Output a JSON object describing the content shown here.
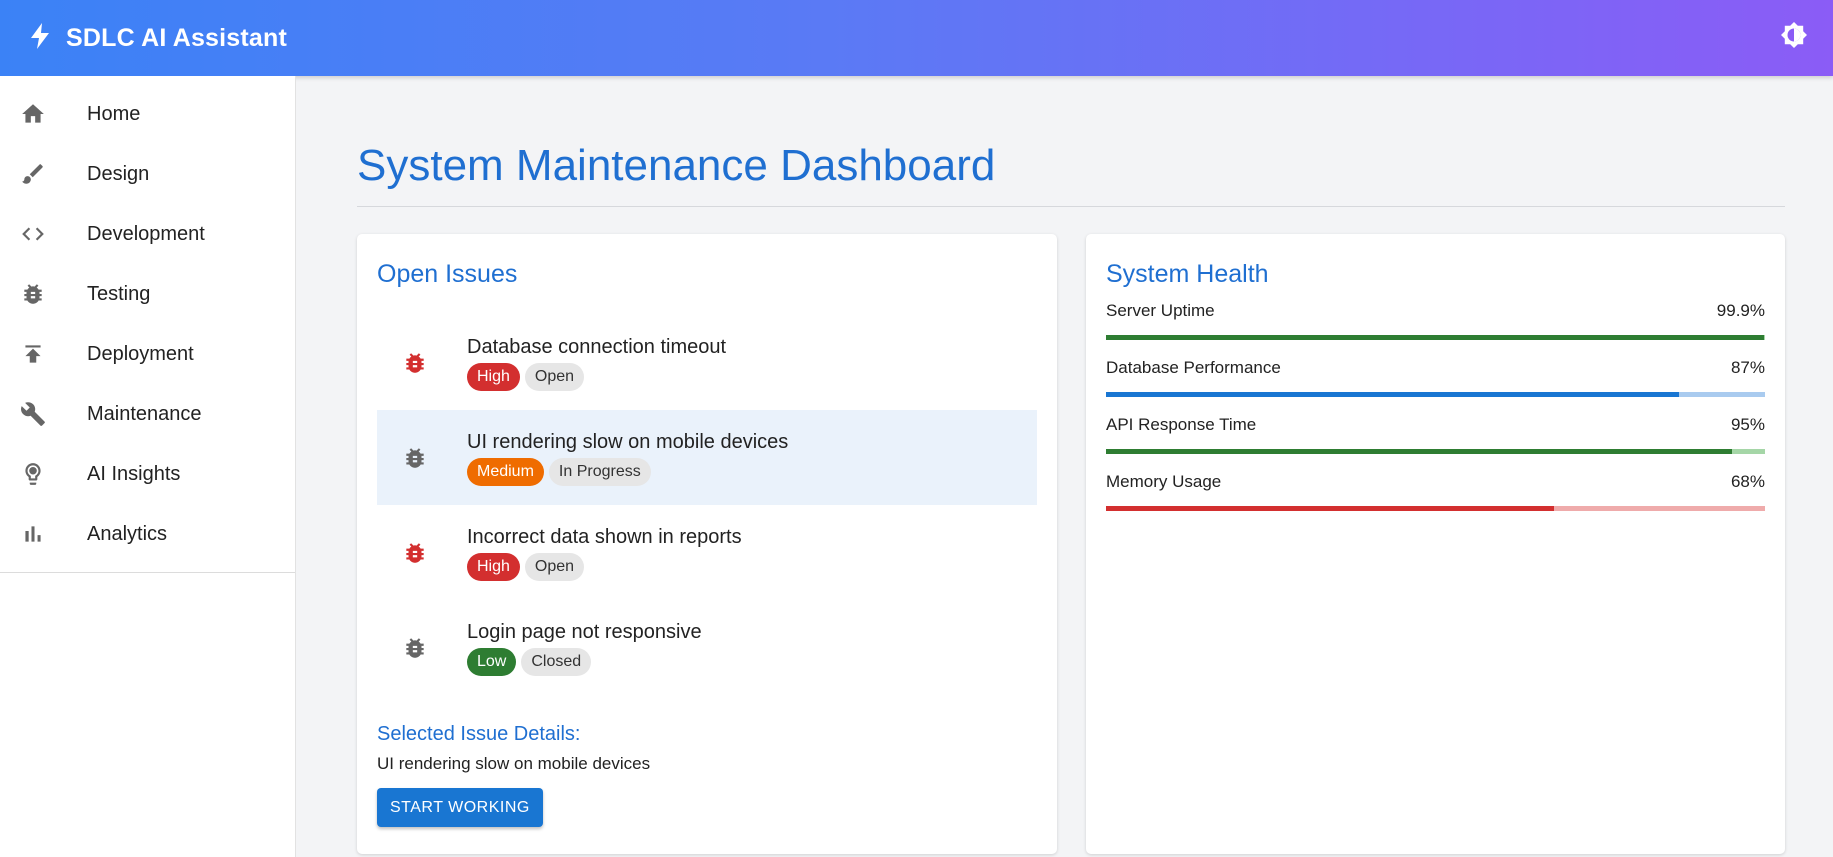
{
  "app": {
    "title": "SDLC AI Assistant",
    "brand_icon": "bolt-icon",
    "theme_icon": "brightness-icon"
  },
  "sidebar": {
    "items": [
      {
        "label": "Home",
        "icon": "home-icon"
      },
      {
        "label": "Design",
        "icon": "brush-icon"
      },
      {
        "label": "Development",
        "icon": "code-icon"
      },
      {
        "label": "Testing",
        "icon": "bug-icon"
      },
      {
        "label": "Deployment",
        "icon": "upload-icon"
      },
      {
        "label": "Maintenance",
        "icon": "wrench-icon"
      },
      {
        "label": "AI Insights",
        "icon": "lightbulb-icon"
      },
      {
        "label": "Analytics",
        "icon": "bar-chart-icon"
      }
    ]
  },
  "page": {
    "title": "System Maintenance Dashboard"
  },
  "issues": {
    "title": "Open Issues",
    "items": [
      {
        "title": "Database connection timeout",
        "priority": "High",
        "status": "Open"
      },
      {
        "title": "UI rendering slow on mobile devices",
        "priority": "Medium",
        "status": "In Progress"
      },
      {
        "title": "Incorrect data shown in reports",
        "priority": "High",
        "status": "Open"
      },
      {
        "title": "Login page not responsive",
        "priority": "Low",
        "status": "Closed"
      }
    ],
    "details_title": "Selected Issue Details:",
    "selected_title": "UI rendering slow on mobile devices",
    "start_label": "START WORKING"
  },
  "health": {
    "title": "System Health",
    "metrics": [
      {
        "label": "Server Uptime",
        "value": "99.9%",
        "fraction": 0.999,
        "color": "#2e7d32",
        "track": "#a5d6a7"
      },
      {
        "label": "Database Performance",
        "value": "87%",
        "fraction": 0.87,
        "color": "#1976d2",
        "track": "#a9cbef"
      },
      {
        "label": "API Response Time",
        "value": "95%",
        "fraction": 0.95,
        "color": "#2e7d32",
        "track": "#a5d6a7"
      },
      {
        "label": "Memory Usage",
        "value": "68%",
        "fraction": 0.68,
        "color": "#d32f2f",
        "track": "#efabab"
      }
    ]
  },
  "colors": {
    "accent": "#1f6fd1",
    "high": "#d32f2f",
    "medium": "#ef6c00",
    "low": "#2e7d32"
  }
}
